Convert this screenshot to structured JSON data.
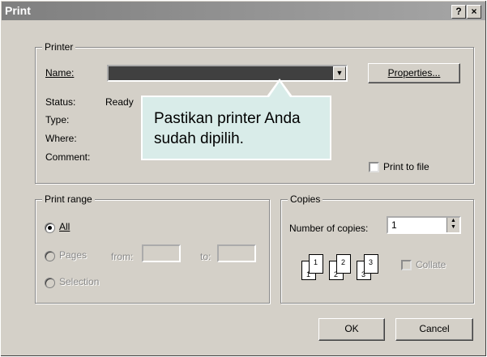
{
  "window": {
    "title": "Print",
    "help_btn": "?",
    "close_btn": "×"
  },
  "printer": {
    "legend": "Printer",
    "name_label": "Name:",
    "name_value": "",
    "properties_label": "Properties...",
    "status_label": "Status:",
    "status_value": "Ready",
    "type_label": "Type:",
    "where_label": "Where:",
    "comment_label": "Comment:",
    "print_to_file_label": "Print to file"
  },
  "callout": {
    "text": "Pastikan printer Anda sudah dipilih."
  },
  "print_range": {
    "legend": "Print range",
    "all_label": "All",
    "pages_label": "Pages",
    "from_label": "from:",
    "to_label": "to:",
    "selection_label": "Selection"
  },
  "copies": {
    "legend": "Copies",
    "number_label": "Number of copies:",
    "number_value": "1",
    "collate_label": "Collate",
    "icon_labels": [
      "1",
      "1",
      "2",
      "2",
      "3",
      "3"
    ]
  },
  "buttons": {
    "ok": "OK",
    "cancel": "Cancel"
  }
}
